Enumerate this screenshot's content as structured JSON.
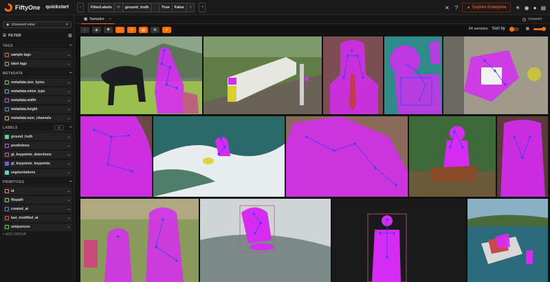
{
  "header": {
    "logo_text": "FiftyOne",
    "dataset": "quickstart",
    "view_stage": {
      "name": "FilterLabels",
      "field": "ground_truth",
      "ellipsis": "...",
      "opt_true": "True",
      "opt_false": "False"
    },
    "enterprise_label": "Explore Enterprise",
    "icons": [
      "help-icon",
      "theme-icon",
      "discord-icon",
      "github-icon",
      "book-icon"
    ]
  },
  "sidebar": {
    "view_select": "Unsaved view",
    "filter_label": "FILTER",
    "groups": [
      {
        "title": "TAGS",
        "fields": [
          "sample tags",
          "label tags"
        ]
      },
      {
        "title": "METADATA",
        "fields": [
          "metadata.size_bytes",
          "metadata.mime_type",
          "metadata.width",
          "metadata.height",
          "metadata.num_channels"
        ]
      },
      {
        "title": "LABELS",
        "count": "2",
        "fields": [
          "ground_truth",
          "predictions",
          "gt_keypoints_detections",
          "gt_keypoints_keypoints",
          "segmentations"
        ]
      },
      {
        "title": "PRIMITIVES",
        "fields": [
          "id",
          "filepath",
          "created_at",
          "last_modified_at",
          "uniqueness"
        ]
      }
    ],
    "add_group": "+ ADD GROUP"
  },
  "colors": {
    "accent": "#ff6d04",
    "mask": "#d62cf2",
    "keypoint": "#3a3cff",
    "field_colors": [
      "#d96a6a",
      "#c7a35b",
      "#8fbf5a",
      "#5ab0bf",
      "#c55ad0",
      "#6a8fd9",
      "#d9b45a",
      "#5ad98f",
      "#b35ad9",
      "#d95ab0",
      "#7a5ad9",
      "#5ad9c7",
      "#d9905a",
      "#90d95a",
      "#5a7ad9",
      "#d95a5a",
      "#5ad95a"
    ]
  },
  "main": {
    "tab": "Samples",
    "unsaved": "Unsaved",
    "samples_count": "94 samples",
    "sort_by": "Sort by"
  }
}
